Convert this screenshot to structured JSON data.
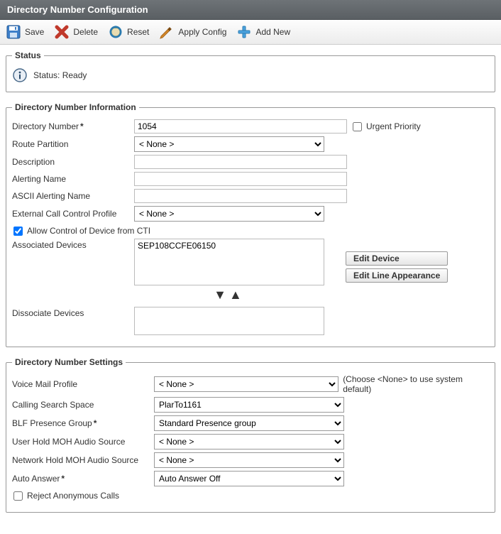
{
  "title": "Directory Number Configuration",
  "toolbar": {
    "save": "Save",
    "delete": "Delete",
    "reset": "Reset",
    "apply": "Apply Config",
    "addnew": "Add New"
  },
  "status": {
    "legend": "Status",
    "text": "Status: Ready"
  },
  "info": {
    "legend": "Directory Number Information",
    "directory_number_label": "Directory Number",
    "directory_number_value": "1054",
    "urgent_priority_label": "Urgent Priority",
    "urgent_priority_checked": false,
    "route_partition_label": "Route Partition",
    "route_partition_value": "< None >",
    "description_label": "Description",
    "description_value": "",
    "alerting_name_label": "Alerting Name",
    "alerting_name_value": "",
    "ascii_alerting_name_label": "ASCII Alerting Name",
    "ascii_alerting_name_value": "",
    "ext_call_ctrl_label": "External Call Control Profile",
    "ext_call_ctrl_value": "< None >",
    "allow_cti_label": "Allow Control of Device from CTI",
    "allow_cti_checked": true,
    "associated_devices_label": "Associated Devices",
    "associated_devices_value": "SEP108CCFE06150",
    "edit_device_label": "Edit Device",
    "edit_line_label": "Edit Line Appearance",
    "dissociate_devices_label": "Dissociate Devices",
    "dissociate_devices_value": ""
  },
  "settings": {
    "legend": "Directory Number Settings",
    "voice_mail_label": "Voice Mail Profile",
    "voice_mail_value": "< None >",
    "voice_mail_hint": "(Choose <None> to use system default)",
    "css_label": "Calling Search Space",
    "css_value": "PlarTo1161",
    "blf_label": "BLF Presence Group",
    "blf_value": "Standard Presence group",
    "user_hold_label": "User Hold MOH Audio Source",
    "user_hold_value": "< None >",
    "net_hold_label": "Network Hold MOH Audio Source",
    "net_hold_value": "< None >",
    "auto_answer_label": "Auto Answer",
    "auto_answer_value": "Auto Answer Off",
    "reject_anon_label": "Reject Anonymous Calls",
    "reject_anon_checked": false
  }
}
